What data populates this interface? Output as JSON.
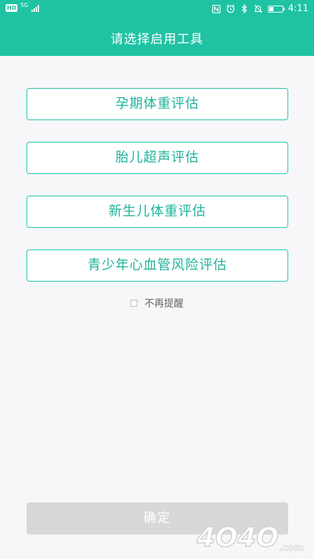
{
  "status_bar": {
    "hd_badge": "HD",
    "network_badge": "5G",
    "time": "4:11",
    "battery_level": 0.35
  },
  "header": {
    "title": "请选择启用工具",
    "background_color": "#1fc3a4"
  },
  "tools": [
    {
      "label": "孕期体重评估"
    },
    {
      "label": "胎儿超声评估"
    },
    {
      "label": "新生儿体重评估"
    },
    {
      "label": "青少年心血管风险评估"
    }
  ],
  "no_remind": {
    "label": "不再提醒",
    "checked": false
  },
  "confirm_button": {
    "label": "确定",
    "enabled": false
  },
  "watermark": {
    "text": "4O4O",
    "suffix": ".com"
  }
}
